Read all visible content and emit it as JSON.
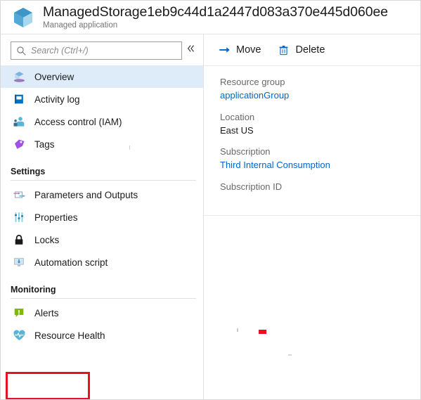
{
  "header": {
    "icon": "managed-application-cube-icon",
    "title": "ManagedStorage1eb9c44d1a2447d083a370e445d060ee",
    "subtitle": "Managed application"
  },
  "sidebar": {
    "search": {
      "placeholder": "Search (Ctrl+/)",
      "value": "",
      "icon": "search-icon"
    },
    "collapse": {
      "icon": "double-chevron-left-icon",
      "label": "«"
    },
    "items": [
      {
        "label": "Overview",
        "icon": "overview-cube-icon",
        "selected": true
      },
      {
        "label": "Activity log",
        "icon": "activity-log-book-icon",
        "selected": false
      },
      {
        "label": "Access control (IAM)",
        "icon": "access-control-people-icon",
        "selected": false
      },
      {
        "label": "Tags",
        "icon": "tag-icon",
        "selected": false
      }
    ],
    "sections": [
      {
        "title": "Settings",
        "items": [
          {
            "label": "Parameters and Outputs",
            "icon": "parameters-outputs-icon"
          },
          {
            "label": "Properties",
            "icon": "properties-sliders-icon"
          },
          {
            "label": "Locks",
            "icon": "lock-icon"
          },
          {
            "label": "Automation script",
            "icon": "automation-script-monitor-icon"
          }
        ]
      },
      {
        "title": "Monitoring",
        "items": [
          {
            "label": "Alerts",
            "icon": "alert-bubble-icon",
            "highlighted": true
          },
          {
            "label": "Resource Health",
            "icon": "resource-health-heart-icon"
          }
        ]
      }
    ]
  },
  "content": {
    "toolbar": [
      {
        "label": "Move",
        "icon": "move-arrow-icon"
      },
      {
        "label": "Delete",
        "icon": "delete-trash-icon"
      }
    ],
    "details": [
      {
        "label": "Resource group",
        "value": "applicationGroup",
        "is_link": true
      },
      {
        "label": "Location",
        "value": "East US",
        "is_link": false
      },
      {
        "label": "Subscription",
        "value": "Third Internal Consumption",
        "is_link": true
      },
      {
        "label": "Subscription ID",
        "value": "",
        "is_link": false
      }
    ]
  },
  "colors": {
    "accent_link": "#0066cc",
    "selected_row": "#deecf9",
    "highlight_box": "#e81123",
    "alert_green": "#7fba00",
    "header_title": "#1b1b1b",
    "muted_text": "#696969"
  }
}
